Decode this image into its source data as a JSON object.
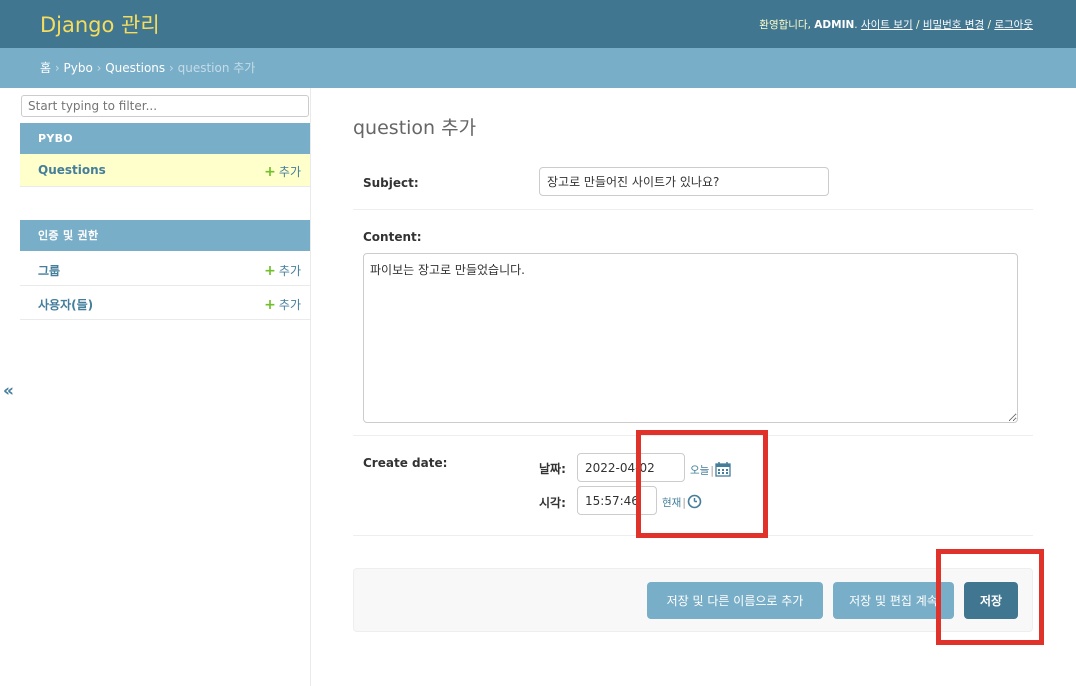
{
  "header": {
    "brand": "Django 관리",
    "welcome_prefix": "환영합니다, ",
    "username": "ADMIN",
    "welcome_suffix": ". ",
    "links": [
      "사이트 보기",
      "비밀번호 변경",
      "로그아웃"
    ],
    "link_sep": " / ",
    "brand_color": "#f5dd5d",
    "bar_color": "#417690"
  },
  "breadcrumbs": {
    "items": [
      "홈",
      "Pybo",
      "Questions"
    ],
    "current": "question 추가",
    "sep": " › "
  },
  "sidebar": {
    "filter_placeholder": "Start typing to filter...",
    "modules": [
      {
        "caption": "PYBO",
        "models": [
          {
            "name": "Questions",
            "add_label": "추가",
            "current": true
          }
        ]
      },
      {
        "caption": "인증 및 권한",
        "models": [
          {
            "name": "그룹",
            "add_label": "추가",
            "current": false
          },
          {
            "name": "사용자(들)",
            "add_label": "추가",
            "current": false
          }
        ]
      }
    ],
    "collapse_icon": "«"
  },
  "content": {
    "title": "question 추가",
    "subject": {
      "label": "Subject:",
      "value": "장고로 만들어진 사이트가 있나요?"
    },
    "content": {
      "label": "Content:",
      "value": "파이보는 장고로 만들었습니다."
    },
    "create_date": {
      "label": "Create date:",
      "date_label": "날짜:",
      "date_value": "2022-04-02",
      "today_link": "오늘",
      "time_label": "시각:",
      "time_value": "15:57:46",
      "now_link": "현재",
      "separator": "|",
      "calendar_icon": "calendar-icon",
      "clock_icon": "clock-icon"
    }
  },
  "buttons": {
    "save_add_another": "저장 및 다른 이름으로 추가",
    "save_continue": "저장 및 편집 계속",
    "save": "저장"
  },
  "annotation_color": "#e0322b"
}
